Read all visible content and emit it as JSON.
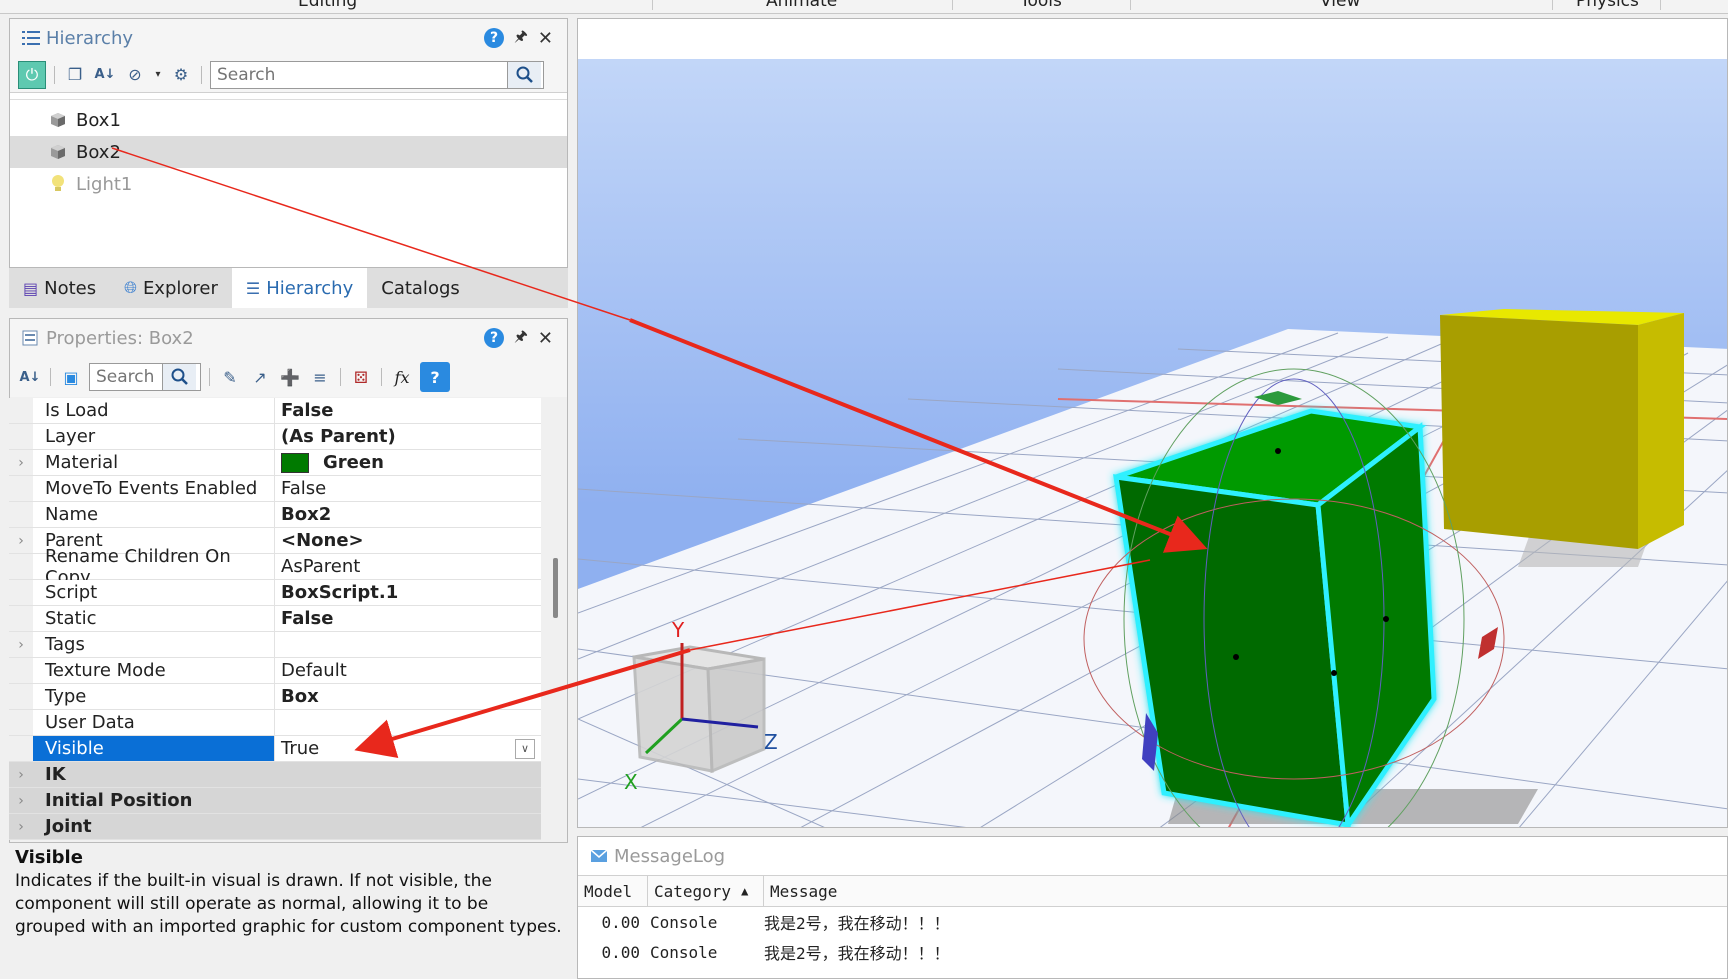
{
  "ribbon": {
    "tabs": [
      "Editing",
      "Animate",
      "Tools",
      "View",
      "Physics"
    ]
  },
  "hierarchy": {
    "title": "Hierarchy",
    "search_placeholder": "Search",
    "items": [
      {
        "label": "Box1",
        "icon": "box-icon"
      },
      {
        "label": "Box2",
        "icon": "box-icon"
      },
      {
        "label": "Light1",
        "icon": "light-bulb-icon"
      }
    ]
  },
  "tabs": [
    {
      "label": "Notes",
      "icon": "notes-icon"
    },
    {
      "label": "Explorer",
      "icon": "globe-icon"
    },
    {
      "label": "Hierarchy",
      "icon": "list-icon"
    },
    {
      "label": "Catalogs"
    }
  ],
  "properties": {
    "title": "Properties: Box2",
    "search_placeholder": "Search",
    "fx_label": "fx",
    "rows": [
      {
        "name": "Is Load",
        "value": "False",
        "bold": true
      },
      {
        "name": "Layer",
        "value": "(As Parent)",
        "bold": true
      },
      {
        "name": "Material",
        "value": "Green",
        "bold": true,
        "expandable": true,
        "swatch": "#007a00"
      },
      {
        "name": "MoveTo Events Enabled",
        "value": "False"
      },
      {
        "name": "Name",
        "value": "Box2",
        "bold": true
      },
      {
        "name": "Parent",
        "value": "<None>",
        "bold": true,
        "expandable": true
      },
      {
        "name": "Rename Children On Copy",
        "value": "AsParent"
      },
      {
        "name": "Script",
        "value": "BoxScript.1",
        "bold": true
      },
      {
        "name": "Static",
        "value": "False",
        "bold": true
      },
      {
        "name": "Tags",
        "value": "",
        "expandable": true
      },
      {
        "name": "Texture Mode",
        "value": "Default"
      },
      {
        "name": "Type",
        "value": "Box",
        "bold": true
      },
      {
        "name": "User Data",
        "value": ""
      },
      {
        "name": "Visible",
        "value": "True",
        "selected": true
      }
    ],
    "categories": [
      "IK",
      "Initial Position",
      "Joint"
    ],
    "description": {
      "title": "Visible",
      "text": "Indicates if the built-in visual is drawn. If not visible, the component will still operate as normal, allowing it to be grouped with an imported graphic for custom component types."
    }
  },
  "viewport": {
    "axis_labels": {
      "x": "X",
      "y": "Y",
      "z": "Z"
    },
    "colors": {
      "box2": "#007a00",
      "box1": "#c8c000",
      "sky_top": "#8fb3f2",
      "floor": "#f4f6fb",
      "highlight": "#2ef0ff",
      "annotation": "#e8281c"
    }
  },
  "messagelog": {
    "title": "MessageLog",
    "columns": [
      "Model",
      "Category",
      "Message"
    ],
    "rows": [
      {
        "model": "0.00",
        "category": "Console",
        "message": "我是2号，我在移动！！！"
      },
      {
        "model": "0.00",
        "category": "Console",
        "message": "我是2号，我在移动！！！"
      }
    ]
  }
}
